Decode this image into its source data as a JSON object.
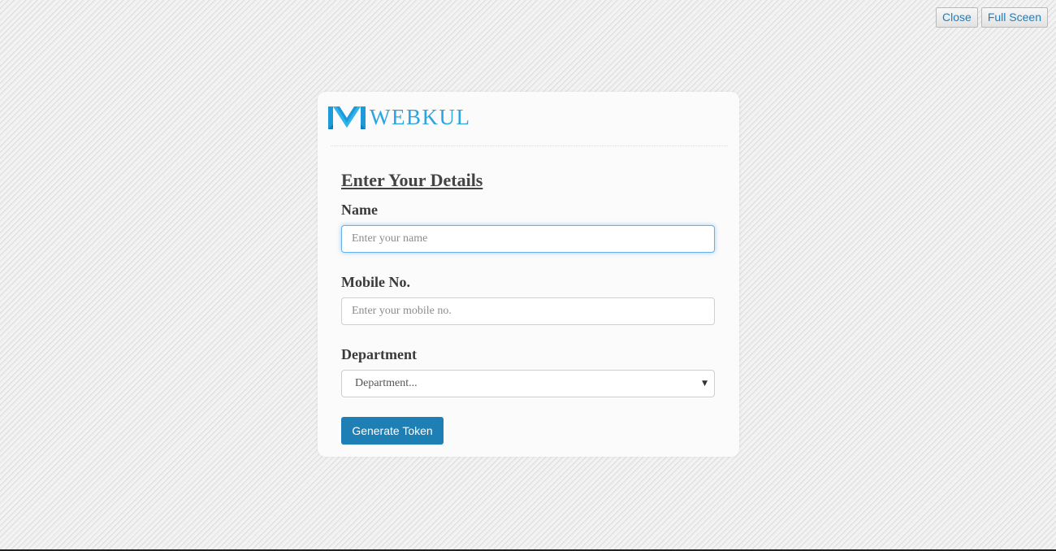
{
  "top_controls": {
    "close_label": "Close",
    "fullscreen_label": "Full Sceen"
  },
  "logo": {
    "icon": "webkul-w-logo-icon",
    "text": "WEBKUL",
    "color": "#2ca4df"
  },
  "form": {
    "title": "Enter Your Details",
    "name": {
      "label": "Name",
      "placeholder": "Enter your name",
      "value": ""
    },
    "mobile": {
      "label": "Mobile No.",
      "placeholder": "Enter your mobile no.",
      "value": ""
    },
    "department": {
      "label": "Department",
      "selected": "Department...",
      "icon": "caret-down-icon"
    },
    "submit_label": "Generate Token"
  },
  "colors": {
    "accent": "#1e7fb5",
    "link": "#1a7fc1",
    "focus": "#66afe9"
  }
}
